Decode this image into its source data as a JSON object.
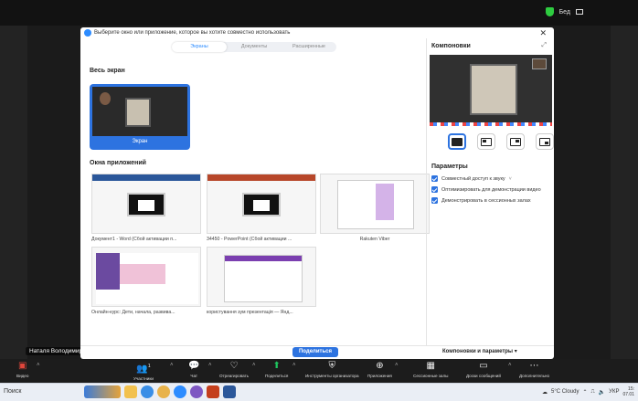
{
  "zoom_top": {
    "status_label": "Бед"
  },
  "video_name": "Наталя Володимир",
  "dialog": {
    "title": "Выберите окно или приложение, которое вы хотите совместно использовать",
    "tabs": [
      {
        "label": "Экраны",
        "active": true
      },
      {
        "label": "Документы",
        "active": false
      },
      {
        "label": "Расширенные",
        "active": false
      }
    ],
    "full_screen_title": "Весь экран",
    "screen_label": "Экран",
    "app_windows_title": "Окна приложений",
    "apps": [
      {
        "caption": "Документ1 - Word (Сбой активации п..."
      },
      {
        "caption": "34450 - PowerPoint (Сбой активации ..."
      },
      {
        "caption": "Rakuten Viber"
      },
      {
        "caption": "Онлайн-курс: Дети, начала, развива..."
      },
      {
        "caption": "користування зум презентація — Янд..."
      }
    ],
    "layouts_title": "Компоновки",
    "params_title": "Параметры",
    "options": [
      {
        "label": "Совместный доступ к звуку",
        "has_caret": true
      },
      {
        "label": "Оптимизировать для демонстрации видео",
        "has_caret": false
      },
      {
        "label": "Демонстрировать в сессионных залах",
        "has_caret": false
      }
    ],
    "share_button": "Поделиться",
    "layouts_params_link": "Компоновки и параметры"
  },
  "toolbar": {
    "items": [
      {
        "label": "Видео",
        "icon": "camera-off-icon"
      },
      {
        "label": "Участники",
        "icon": "participants-icon",
        "count": "1"
      },
      {
        "label": "Чат",
        "icon": "chat-icon"
      },
      {
        "label": "Отреагировать",
        "icon": "heart-icon"
      },
      {
        "label": "Поделиться",
        "icon": "share-icon"
      },
      {
        "label": "Инструменты организатора",
        "icon": "shield-icon"
      },
      {
        "label": "Приложения",
        "icon": "apps-icon"
      },
      {
        "label": "Сессионные залы",
        "icon": "breakout-rooms-icon"
      },
      {
        "label": "Доски сообщений",
        "icon": "whiteboard-icon"
      },
      {
        "label": "Дополнительно",
        "icon": "more-icon"
      }
    ]
  },
  "taskbar": {
    "search_label": "Поиск",
    "weather": "5°C Cloudy",
    "language": "УКР",
    "clock_time": "15:",
    "clock_date": "07.01"
  },
  "colors": {
    "accent": "#2d73e0",
    "zoom_green": "#1ec45f",
    "video_off_red": "#e0453b"
  }
}
